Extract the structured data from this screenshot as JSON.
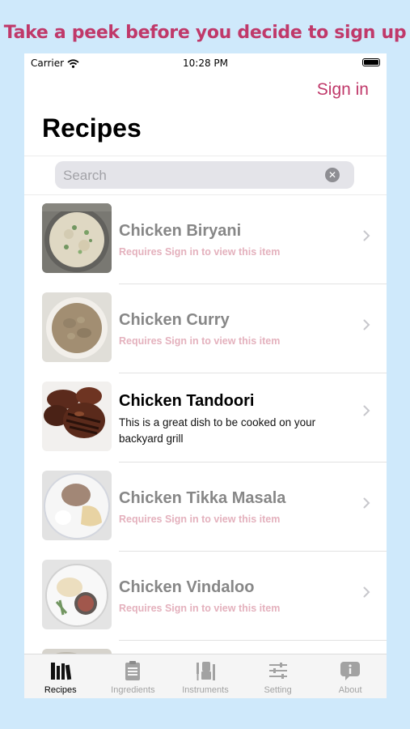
{
  "banner": "Take a peek before you decide to sign up",
  "status_bar": {
    "carrier": "Carrier",
    "time": "10:28 PM"
  },
  "header": {
    "sign_in": "Sign in",
    "title": "Recipes"
  },
  "search": {
    "placeholder": "Search",
    "value": ""
  },
  "recipes": [
    {
      "name": "Chicken Biryani",
      "subtitle": "Requires Sign in to view this item",
      "locked": true,
      "image": "biryani-photo"
    },
    {
      "name": "Chicken Curry",
      "subtitle": "Requires Sign in to view this item",
      "locked": true,
      "image": "curry-photo"
    },
    {
      "name": "Chicken Tandoori",
      "subtitle": "This is a great dish to be cooked on your backyard grill",
      "locked": false,
      "image": "tandoori-photo"
    },
    {
      "name": "Chicken Tikka Masala",
      "subtitle": "Requires Sign in to view this item",
      "locked": true,
      "image": "tikka-masala-photo"
    },
    {
      "name": "Chicken Vindaloo",
      "subtitle": "Requires Sign in to view this item",
      "locked": true,
      "image": "vindaloo-photo"
    }
  ],
  "tab_bar": {
    "tabs": [
      {
        "label": "Recipes",
        "icon": "books-icon",
        "active": true
      },
      {
        "label": "Ingredients",
        "icon": "clipboard-icon",
        "active": false
      },
      {
        "label": "Instruments",
        "icon": "kitchen-tools-icon",
        "active": false
      },
      {
        "label": "Setting",
        "icon": "sliders-icon",
        "active": false
      },
      {
        "label": "About",
        "icon": "info-bubble-icon",
        "active": false
      }
    ]
  },
  "colors": {
    "accent": "#c0396a",
    "background": "#cfe9fb",
    "locked_title": "#878787",
    "locked_subtitle": "#e4b1bd"
  }
}
